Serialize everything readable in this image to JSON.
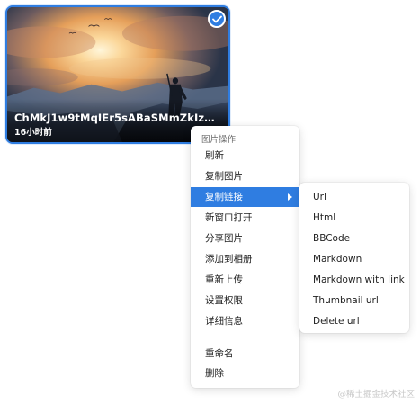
{
  "card": {
    "filename": "ChMkJ1w9tMqIEr5sABaSMmZkIzwAAuZvQ...",
    "time": "16小时前",
    "selected": true,
    "accent": "#2f7de1",
    "image_subject": "warrior-on-cliff-at-sunset"
  },
  "menu": {
    "header": "图片操作",
    "items": [
      {
        "label": "刷新"
      },
      {
        "label": "复制图片"
      },
      {
        "label": "复制链接",
        "active": true,
        "has_submenu": true
      },
      {
        "label": "新窗口打开"
      },
      {
        "label": "分享图片"
      },
      {
        "label": "添加到相册"
      },
      {
        "label": "重新上传"
      },
      {
        "label": "设置权限"
      },
      {
        "label": "详细信息"
      }
    ],
    "extra_items": [
      {
        "label": "重命名"
      },
      {
        "label": "删除"
      }
    ],
    "active_color": "#2f7de1"
  },
  "submenu": {
    "items": [
      {
        "label": "Url"
      },
      {
        "label": "Html"
      },
      {
        "label": "BBCode"
      },
      {
        "label": "Markdown"
      },
      {
        "label": "Markdown with link"
      },
      {
        "label": "Thumbnail url"
      },
      {
        "label": "Delete url"
      }
    ]
  },
  "watermark": "@稀土掘金技术社区"
}
